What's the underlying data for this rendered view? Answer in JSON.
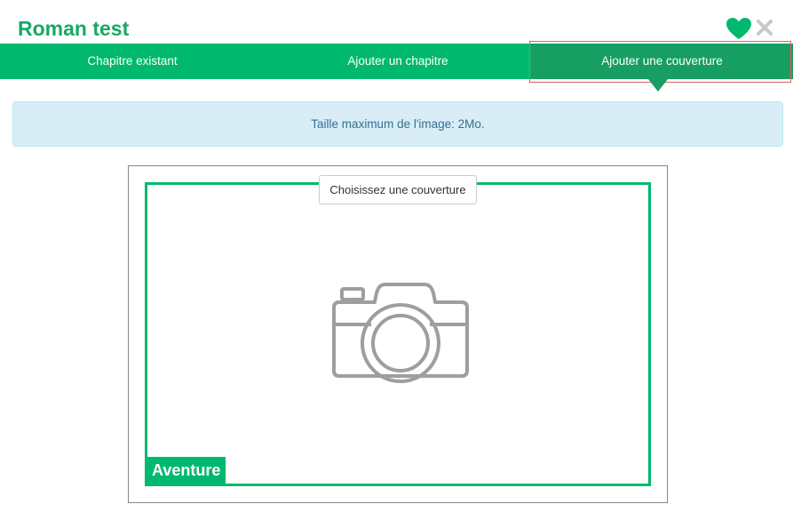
{
  "header": {
    "title": "Roman test",
    "favorite_icon": "heart-icon",
    "close_icon": "close-icon",
    "accent_color": "#17a865"
  },
  "tabs": [
    {
      "label": "Chapitre existant",
      "active": false
    },
    {
      "label": "Ajouter un chapitre",
      "active": false
    },
    {
      "label": "Ajouter une couverture",
      "active": true
    }
  ],
  "alert": {
    "message": "Taille maximum de l'image: 2Mo."
  },
  "cover": {
    "choose_button_label": "Choisissez une couverture",
    "placeholder_icon": "camera-icon",
    "genre_label": "Aventure"
  },
  "colors": {
    "primary": "#00b86e",
    "tab_active": "#179e62",
    "alert_bg": "#d9edf7",
    "alert_text": "#31708f",
    "icon_gray": "#9e9e9e"
  }
}
